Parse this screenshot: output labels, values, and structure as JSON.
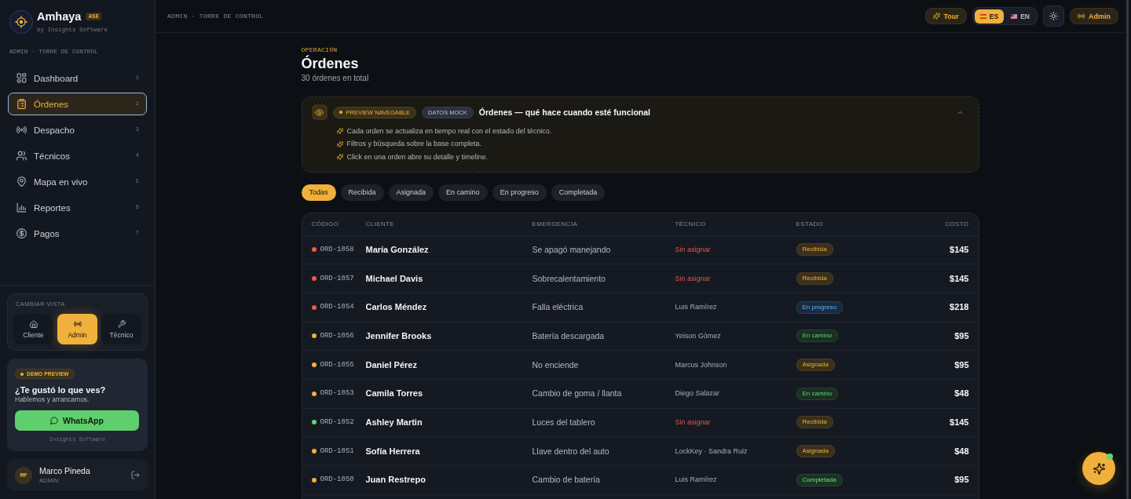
{
  "sidebar": {
    "brand": {
      "name": "Amhaya",
      "tag": "ASE",
      "byline": "by Insights Software"
    },
    "context": "ADMIN · TORRE DE CONTROL",
    "nav": [
      {
        "label": "Dashboard",
        "shortcut": "1",
        "selected": false
      },
      {
        "label": "Órdenes",
        "shortcut": "2",
        "selected": true
      },
      {
        "label": "Despacho",
        "shortcut": "3",
        "selected": false
      },
      {
        "label": "Técnicos",
        "shortcut": "4",
        "selected": false
      },
      {
        "label": "Mapa en vivo",
        "shortcut": "5",
        "selected": false
      },
      {
        "label": "Reportes",
        "shortcut": "6",
        "selected": false
      },
      {
        "label": "Pagos",
        "shortcut": "7",
        "selected": false
      }
    ],
    "view_switcher": {
      "title": "CAMBIAR VISTA",
      "options": [
        {
          "label": "Cliente",
          "selected": false
        },
        {
          "label": "Admin",
          "selected": true
        },
        {
          "label": "Técnico",
          "selected": false
        }
      ]
    },
    "promo": {
      "badge": "DEMO PREVIEW",
      "title": "¿Te gustó lo que ves?",
      "text": "Hablemos y arrancamos.",
      "button": "WhatsApp",
      "footer": "Insights Software"
    },
    "user": {
      "initials": "MP",
      "name": "Marco Pineda",
      "role": "ADMIN"
    }
  },
  "topbar": {
    "breadcrumb": "ADMIN · TORRE DE CONTROL",
    "tour_button": "Tour",
    "languages": [
      {
        "label": "ES",
        "selected": true
      },
      {
        "label": "EN",
        "selected": false
      }
    ],
    "role_button": "Admin"
  },
  "page": {
    "eyebrow": "OPERACIÓN",
    "title": "Órdenes",
    "subtitle": "30 órdenes en total"
  },
  "notice": {
    "badges": [
      {
        "label": "PREVIEW NAVEGABLE",
        "kind": "preview"
      },
      {
        "label": "DATOS MOCK",
        "kind": "mock"
      }
    ],
    "title": "Órdenes — qué hace cuando esté funcional",
    "expanded": true,
    "points": [
      "Cada orden se actualiza en tiempo real con el estado del técnico.",
      "Filtros y búsqueda sobre la base completa.",
      "Click en una orden abre su detalle y timeline."
    ]
  },
  "filters": [
    {
      "label": "Todas",
      "selected": true
    },
    {
      "label": "Recibida",
      "selected": false
    },
    {
      "label": "Asignada",
      "selected": false
    },
    {
      "label": "En camino",
      "selected": false
    },
    {
      "label": "En progreso",
      "selected": false
    },
    {
      "label": "Completada",
      "selected": false
    }
  ],
  "table": {
    "columns": [
      "CÓDIGO",
      "CLIENTE",
      "EMERGENCIA",
      "TÉCNICO",
      "ESTADO",
      "COSTO"
    ],
    "rows": [
      {
        "code": "ORD-1058",
        "color": "#ef5a4a",
        "client": "María González",
        "emergency": "Se apagó manejando",
        "technician": "Sin asignar",
        "assigned": false,
        "status": {
          "label": "Recibida",
          "kind": "received"
        },
        "cost": "$145"
      },
      {
        "code": "ORD-1057",
        "color": "#ef5a4a",
        "client": "Michael Davis",
        "emergency": "Sobrecalentamiento",
        "technician": "Sin asignar",
        "assigned": false,
        "status": {
          "label": "Recibida",
          "kind": "received"
        },
        "cost": "$145"
      },
      {
        "code": "ORD-1054",
        "color": "#ef5a4a",
        "client": "Carlos Méndez",
        "emergency": "Falla eléctrica",
        "technician": "Luis Ramírez",
        "assigned": true,
        "status": {
          "label": "En progreso",
          "kind": "in_progress"
        },
        "cost": "$218"
      },
      {
        "code": "ORD-1056",
        "color": "#f0b03c",
        "client": "Jennifer Brooks",
        "emergency": "Batería descargada",
        "technician": "Yeison Gómez",
        "assigned": true,
        "status": {
          "label": "En camino",
          "kind": "en_route"
        },
        "cost": "$95"
      },
      {
        "code": "ORD-1055",
        "color": "#f0b03c",
        "client": "Daniel Pérez",
        "emergency": "No enciende",
        "technician": "Marcus Johnson",
        "assigned": true,
        "status": {
          "label": "Asignada",
          "kind": "assigned"
        },
        "cost": "$95"
      },
      {
        "code": "ORD-1053",
        "color": "#f0b03c",
        "client": "Camila Torres",
        "emergency": "Cambio de goma / llanta",
        "technician": "Diego Salazar",
        "assigned": true,
        "status": {
          "label": "En camino",
          "kind": "en_route"
        },
        "cost": "$48"
      },
      {
        "code": "ORD-1052",
        "color": "#5ed47a",
        "client": "Ashley Martin",
        "emergency": "Luces del tablero",
        "technician": "Sin asignar",
        "assigned": false,
        "status": {
          "label": "Recibida",
          "kind": "received"
        },
        "cost": "$145"
      },
      {
        "code": "ORD-1051",
        "color": "#f0b03c",
        "client": "Sofía Herrera",
        "emergency": "Llave dentro del auto",
        "technician": "LockKey · Sandra Ruiz",
        "assigned": true,
        "status": {
          "label": "Asignada",
          "kind": "assigned"
        },
        "cost": "$48"
      },
      {
        "code": "ORD-1050",
        "color": "#f0b03c",
        "client": "Juan Restrepo",
        "emergency": "Cambio de batería",
        "technician": "Luis Ramírez",
        "assigned": true,
        "status": {
          "label": "Completada",
          "kind": "completed"
        },
        "cost": "$95"
      }
    ]
  },
  "assistant": {
    "online": true
  }
}
